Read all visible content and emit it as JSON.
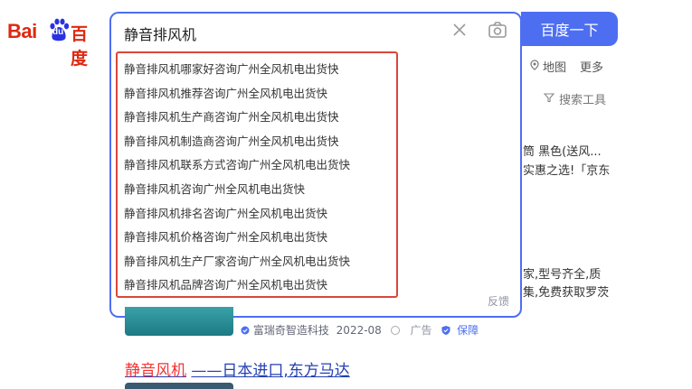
{
  "logo": {
    "bai": "Bai",
    "du": "du",
    "cn": "百度"
  },
  "search": {
    "query": "静音排风机",
    "button_label": "百度一下",
    "feedback": "反馈",
    "suggestions": [
      "静音排风机哪家好咨询广州全风机电出货快",
      "静音排风机推荐咨询广州全风机电出货快",
      "静音排风机生产商咨询广州全风机电出货快",
      "静音排风机制造商咨询广州全风机电出货快",
      "静音排风机联系方式咨询广州全风机电出货快",
      "静音排风机咨询广州全风机电出货快",
      "静音排风机排名咨询广州全风机电出货快",
      "静音排风机价格咨询广州全风机电出货快",
      "静音排风机生产厂家咨询广州全风机电出货快",
      "静音排风机品牌咨询广州全风机电出货快"
    ]
  },
  "nav": {
    "map": "地图",
    "more": "更多",
    "tools": "搜索工具"
  },
  "fragments": {
    "f1": "筒 黑色(送风...",
    "f2": "实惠之选!「京东",
    "f3": "家,型号齐全,质",
    "f4": "集,免费获取罗茨"
  },
  "ad": {
    "company": "富瑞奇智造科技",
    "date": "2022-08",
    "adv": "广告",
    "guarantee": "保障"
  },
  "result": {
    "highlight": "静音风机",
    "rest": "——日本进口,东方马达"
  },
  "colors": {
    "brand": "#4e6ef2",
    "logo_red": "#de2910",
    "frame_red": "#d9473a"
  }
}
